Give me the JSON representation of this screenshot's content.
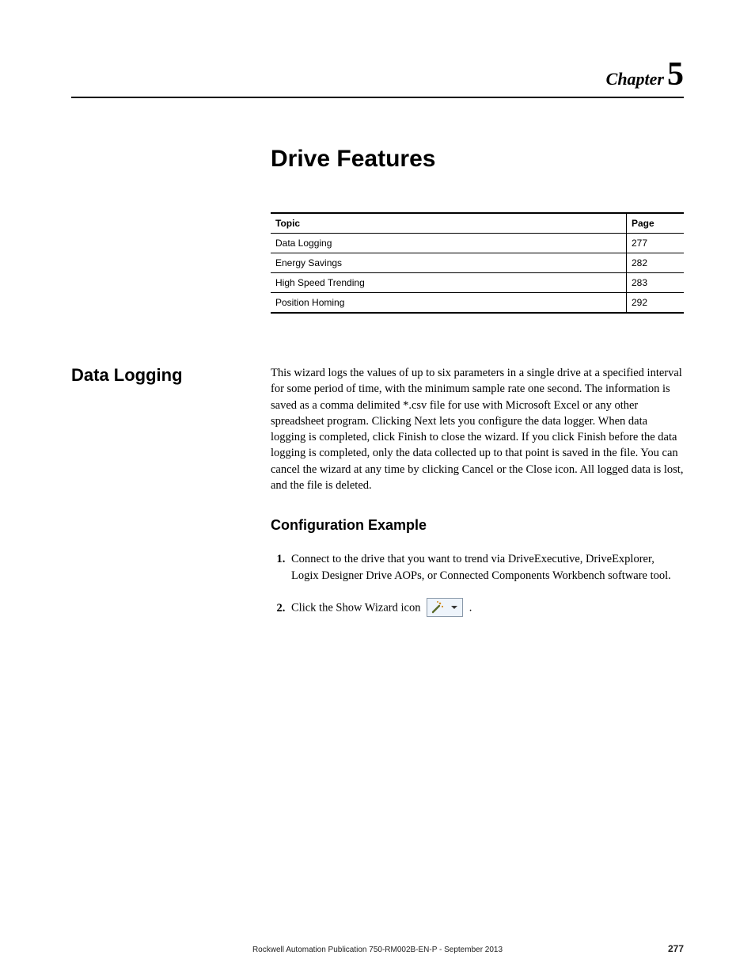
{
  "chapter": {
    "label": "Chapter",
    "number": "5"
  },
  "title": "Drive Features",
  "toc": {
    "headers": {
      "topic": "Topic",
      "page": "Page"
    },
    "rows": [
      {
        "topic": "Data Logging",
        "page": "277"
      },
      {
        "topic": "Energy Savings",
        "page": "282"
      },
      {
        "topic": "High Speed Trending",
        "page": "283"
      },
      {
        "topic": "Position Homing",
        "page": "292"
      }
    ]
  },
  "section": {
    "heading": "Data Logging",
    "body": "This wizard logs the values of up to six parameters in a single drive at a specified interval for some period of time, with the minimum sample rate one second. The information is saved as a comma delimited *.csv file for use with Microsoft Excel or any other spreadsheet program. Clicking Next lets you configure the data logger. When data logging is completed, click Finish to close the wizard. If you click Finish before the data logging is completed, only the data collected up to that point is saved in the file. You can cancel the wizard at any time by clicking Cancel or the Close icon. All logged data is lost, and the file is deleted."
  },
  "example": {
    "heading": "Configuration Example",
    "steps": [
      "Connect to the drive that you want to trend via DriveExecutive, DriveExplorer, Logix Designer Drive AOPs, or Connected Components Workbench software tool.",
      "Click the Show Wizard icon"
    ],
    "step2_trailing": "."
  },
  "footer": {
    "publication": "Rockwell Automation Publication 750-RM002B-EN-P - September 2013",
    "page_number": "277"
  }
}
